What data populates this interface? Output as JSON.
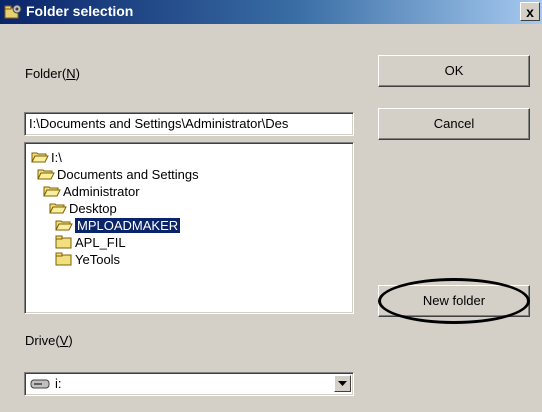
{
  "window": {
    "title": "Folder selection",
    "close_glyph": "x"
  },
  "folder_label": {
    "prefix": "Folder(",
    "mnemonic": "N",
    "suffix": ")"
  },
  "path_field": {
    "value": "I:\\Documents and Settings\\Administrator\\Des"
  },
  "buttons": {
    "ok": "OK",
    "cancel": "Cancel",
    "new_folder": "New folder"
  },
  "tree": {
    "items": [
      {
        "label": "I:\\",
        "icon": "open-folder-icon",
        "selected": false
      },
      {
        "label": "Documents and Settings",
        "icon": "open-folder-icon",
        "selected": false
      },
      {
        "label": "Administrator",
        "icon": "open-folder-icon",
        "selected": false
      },
      {
        "label": "Desktop",
        "icon": "open-folder-icon",
        "selected": false
      },
      {
        "label": "MPLOADMAKER",
        "icon": "open-folder-icon",
        "selected": true
      },
      {
        "label": "APL_FIL",
        "icon": "closed-folder-icon",
        "selected": false
      },
      {
        "label": "YeTools",
        "icon": "closed-folder-icon",
        "selected": false
      }
    ]
  },
  "drive_label": {
    "prefix": "Drive(",
    "mnemonic": "V",
    "suffix": ")"
  },
  "drive_combo": {
    "value": "i:",
    "icon": "drive-icon"
  },
  "colors": {
    "title_start": "#0a246a",
    "title_end": "#a6caf0",
    "selection": "#0a246a",
    "dialog_face": "#d4d0c8"
  }
}
